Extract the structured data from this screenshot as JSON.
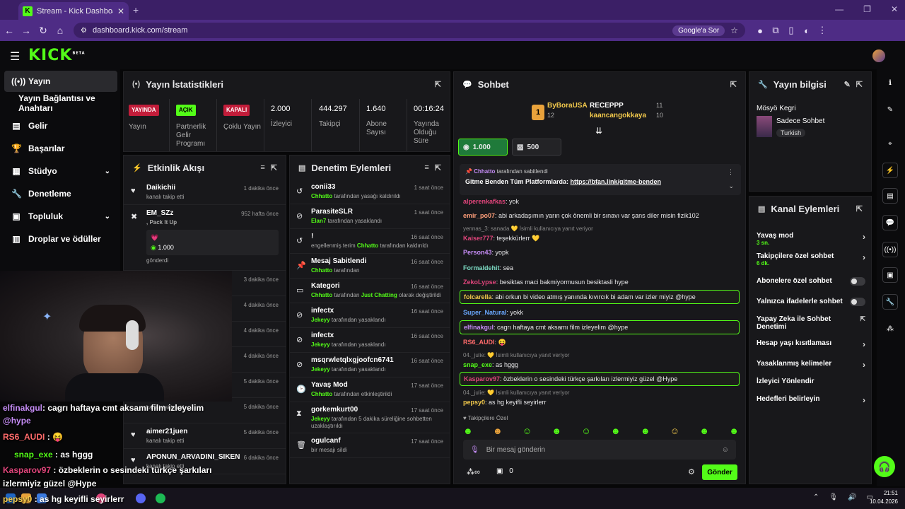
{
  "browser": {
    "tab_title": "Stream - Kick Dashboard",
    "favicon_letter": "K",
    "url": "dashboard.kick.com/stream",
    "google_search": "Google'a Sor"
  },
  "app": {
    "logo": "KICK",
    "logo_sup": "BETA"
  },
  "sidebar": {
    "items": [
      {
        "label": "Yayın"
      },
      {
        "label": "Yayın Bağlantısı ve Anahtarı"
      },
      {
        "label": "Gelir"
      },
      {
        "label": "Başarılar"
      },
      {
        "label": "Stüdyo"
      },
      {
        "label": "Denetleme"
      },
      {
        "label": "Topluluk"
      },
      {
        "label": "Droplar ve ödüller"
      }
    ]
  },
  "stats": {
    "title": "Yayın İstatistikleri",
    "cols": [
      {
        "badge": "YAYINDA",
        "label": "Yayın"
      },
      {
        "badge": "AÇIK",
        "label": "Partnerlik Gelir Programı"
      },
      {
        "badge": "KAPALI",
        "label": "Çoklu Yayın"
      },
      {
        "value": "2.000",
        "label": "İzleyici"
      },
      {
        "value": "444.297",
        "label": "Takipçi"
      },
      {
        "value": "1.640",
        "label": "Abone Sayısı"
      },
      {
        "value": "00:16:24",
        "label": "Yayında Olduğu Süre"
      }
    ]
  },
  "activity": {
    "title": "Etkinlik Akışı",
    "rows": [
      {
        "name": "Daikichii",
        "sub": "kanalı takip etti",
        "time": "1 dakika önce"
      },
      {
        "name": "EM_SZz",
        "sub": ", Pack It Up",
        "time": "952 hafta önce",
        "amount": "1.000",
        "note": "gönderdi"
      },
      {
        "name": "",
        "sub": "",
        "time": "3 dakika önce"
      },
      {
        "name": "",
        "sub": "",
        "time": "4 dakika önce"
      },
      {
        "name": "",
        "sub": "",
        "time": "4 dakika önce"
      },
      {
        "name": "",
        "sub": "",
        "time": "4 dakika önce"
      },
      {
        "name": "",
        "sub": "",
        "time": "5 dakika önce"
      },
      {
        "name": "",
        "sub": "kanalı takip etti",
        "time": "5 dakika önce"
      },
      {
        "name": "aimer21juen",
        "sub": "kanalı takip etti",
        "time": "5 dakika önce"
      },
      {
        "name": "APONUN_ARVADINI_SIKEN",
        "sub": "kanalı takip etti",
        "time": "6 dakika önce"
      }
    ]
  },
  "moderation": {
    "title": "Denetim Eylemleri",
    "rows": [
      {
        "name": "conii33",
        "actor": "Chhatto",
        "text": " tarafından yasağı kaldırıldı",
        "time": "1 saat önce"
      },
      {
        "name": "ParasiteSLR",
        "actor": "Elan7",
        "text": " tarafından yasaklandı",
        "time": "1 saat önce"
      },
      {
        "name": "!",
        "pre": "engellenmiş terim ",
        "actor": "Chhatto",
        "text": " tarafından kaldırıldı",
        "time": "16 saat önce"
      },
      {
        "name": "Mesaj Sabitlendi",
        "actor": "Chhatto",
        "text": " tarafından",
        "time": "16 saat önce"
      },
      {
        "name": "Kategori",
        "actor": "Chhatto",
        "text": " tarafından ",
        "extra": "Just Chatting",
        "text2": " olarak değiştirildi",
        "time": "16 saat önce"
      },
      {
        "name": "infectx",
        "actor": "Jekeyy",
        "text": " tarafından yasaklandı",
        "time": "16 saat önce"
      },
      {
        "name": "infectx",
        "actor": "Jekeyy",
        "text": " tarafından yasaklandı",
        "time": "16 saat önce"
      },
      {
        "name": "msqrwletqlxgjoofcn6741",
        "actor": "Jekeyy",
        "text": " tarafından yasaklandı",
        "time": "16 saat önce"
      },
      {
        "name": "Yavaş Mod",
        "actor": "Chhatto",
        "text": " tarafından etkinleştirildi",
        "time": "17 saat önce"
      },
      {
        "name": "gorkemkurt00",
        "actor": "Jekeyy",
        "text": " tarafından 5 dakika süreliğine sohbetten uzaklaştırıldı",
        "time": "17 saat önce"
      },
      {
        "name": "ogulcanf",
        "actor": "",
        "text": "bir mesajı sildi",
        "time": "17 saat önce"
      }
    ]
  },
  "chat": {
    "title": "Sohbet",
    "top": {
      "rank": "1",
      "user1": "ByBoraUSA",
      "count1": "12",
      "user2": "RECEPPP",
      "count2": "11",
      "user3": "kaancangokkaya",
      "count3": "10"
    },
    "gift1": "1.000",
    "gift2": "500",
    "pinned_by": "Chhatto",
    "pinned_suffix": " tarafından sabitlendi",
    "pinned_text": "Gitme Benden Tüm Platformlarda: ",
    "pinned_link": "https://bfan.link/gitme-benden",
    "messages": [
      {
        "user": "alperenkafkas",
        "color": "#e0457b",
        "text": ": yok"
      },
      {
        "user": "emir_po07",
        "color": "#ff9f7a",
        "text": ": abi arkadaşımın yarın çok önemli bir sınavı var şans diler misin fizik102"
      },
      {
        "reply": "yennas_3: sanada 💛 İsimli kullanıcıya yanıt veriyor"
      },
      {
        "user": "Kaiser777",
        "color": "#e0457b",
        "text": ": teşekkürlerr 💛"
      },
      {
        "user": "Person43",
        "color": "#c58cf5",
        "text": ": yopk"
      },
      {
        "user": "Formaldehit",
        "color": "#7bd9c2",
        "text": ": sea"
      },
      {
        "user": "ZekoLypse",
        "color": "#e0457b",
        "text": ": besiktas maci bakmiyormusun besiktasli hype"
      },
      {
        "user": "folcarella",
        "color": "#f2c94c",
        "text": ": abi orkun bi video atmış yanında kıvırcık bi adam var izler miyiz @hype",
        "boxed": true
      },
      {
        "user": "Super_Natural",
        "color": "#6aa8ff",
        "text": ": yokk"
      },
      {
        "user": "elfinakgul",
        "color": "#c58cf5",
        "text": ": cagrı haftaya cmt aksamı film izleyelim @hype",
        "boxed": true
      },
      {
        "user": "RS6_AUDI",
        "color": "#ff6b6b",
        "text": ": 😝"
      },
      {
        "reply": "04._julie: 💛 İsimli kullanıcıya yanıt veriyor"
      },
      {
        "user": "snap_exe",
        "color": "#53fc18",
        "text": ": as hggg"
      },
      {
        "user": "Kasparov97",
        "color": "#e0457b",
        "text": ": özbeklerin o sesindeki türkçe şarkıları izlermiyiz güzel @Hype",
        "boxed": true
      },
      {
        "reply": "04._julie: 💛 İsimli kullanıcıya yanıt veriyor"
      },
      {
        "user": "pepsy0",
        "color": "#f2c94c",
        "text": ": as hg keyifli seyirlerr"
      }
    ],
    "followers_only": "Takipçilere Özel",
    "input_placeholder": "Bir mesaj gönderin",
    "kick_count": "0",
    "send": "Gönder"
  },
  "info": {
    "title": "Yayın bilgisi",
    "stream_title": "Mösyö Kegri",
    "category": "Sadece Sohbet",
    "language": "Turkish"
  },
  "channel_actions": {
    "title": "Kanal Eylemleri",
    "items": [
      {
        "label": "Yavaş mod",
        "sub": "3 sn."
      },
      {
        "label": "Takipçilere özel sohbet",
        "sub": "6 dk."
      },
      {
        "label": "Abonelere özel sohbet"
      },
      {
        "label": "Yalnızca ifadelerle sohbet"
      },
      {
        "label": "Yapay Zeka ile Sohbet Denetimi"
      },
      {
        "label": "Hesap yaşı kısıtlaması"
      },
      {
        "label": "Yasaklanmış kelimeler"
      },
      {
        "label": "İzleyici Yönlendir"
      },
      {
        "label": "Hedefleri belirleyin"
      }
    ]
  },
  "overlay": {
    "lines": [
      {
        "user": "elfinakgul",
        "text": ": cagrı haftaya cmt aksamı film izleyelim"
      },
      {
        "user": "",
        "text": "@hype"
      },
      {
        "user": "RS6_AUDI",
        "text": " : 😝"
      },
      {
        "user": "snap_exe",
        "text": " : as hggg"
      },
      {
        "user": "Kasparov97",
        "text": " : özbeklerin o sesindeki türkçe şarkıları"
      },
      {
        "user": "",
        "text": "izlermiyiz güzel @Hype"
      },
      {
        "user": "pepsy0",
        "text": " : as hg keyifli seyirlerr"
      }
    ]
  },
  "taskbar": {
    "time": "21:51",
    "date": "10.04.2026"
  },
  "colors": {
    "brand": "#53fc18",
    "browser": "#4e2c85",
    "panel": "#18181b"
  }
}
